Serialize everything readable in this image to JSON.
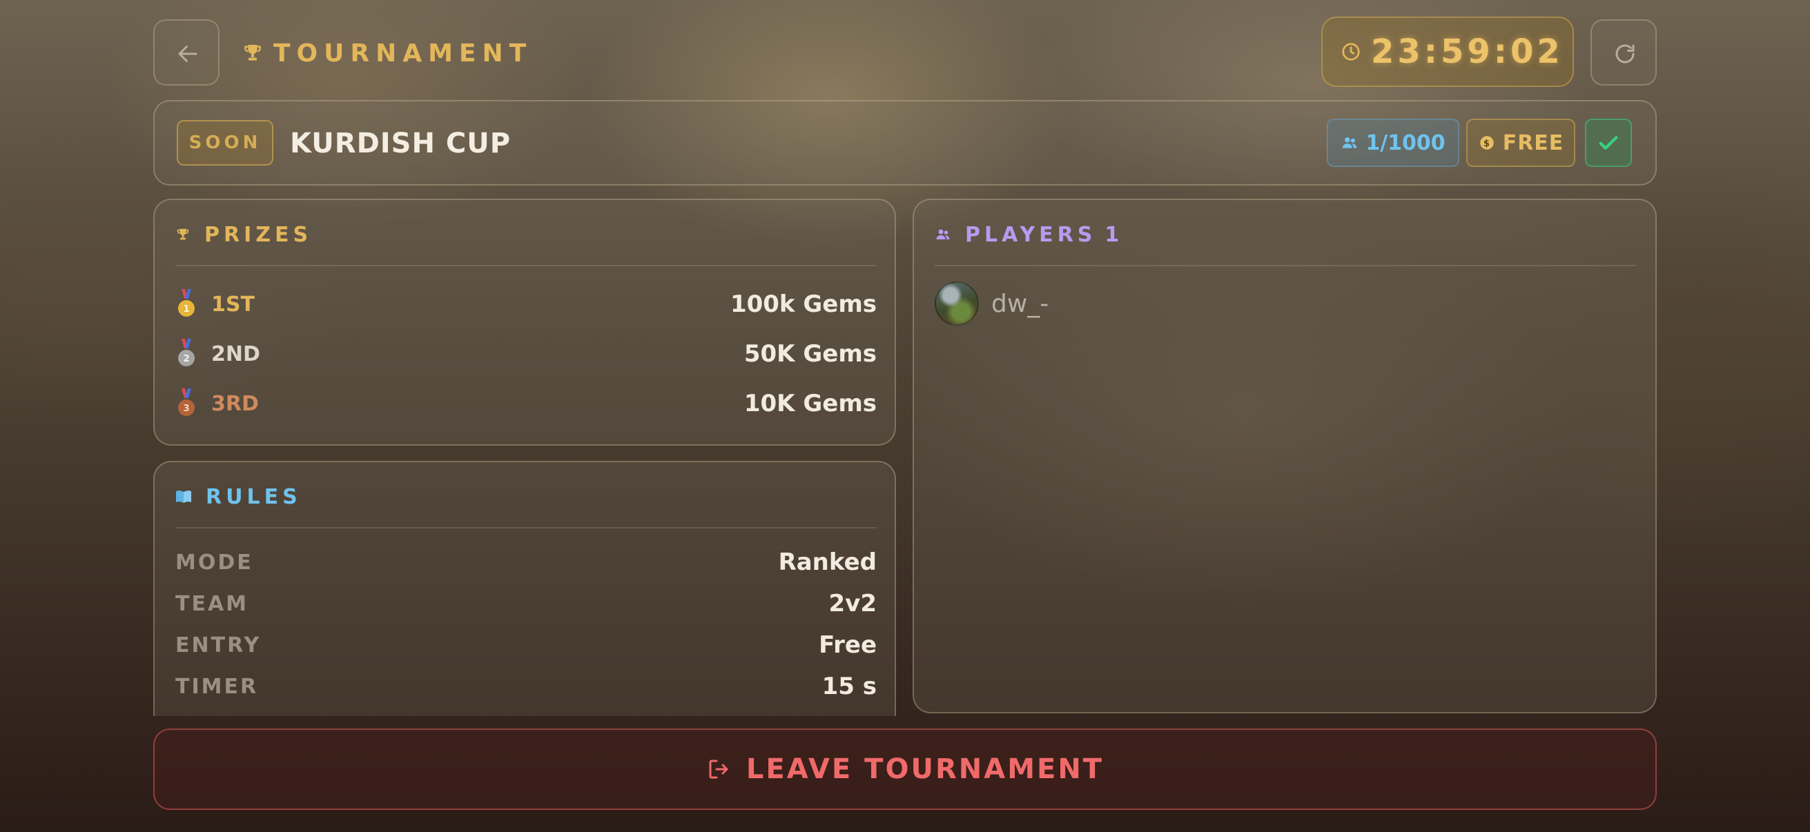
{
  "header": {
    "title": "TOURNAMENT",
    "timer": "23:59:02",
    "colors": {
      "gold": "#e3b65a"
    }
  },
  "event": {
    "status_badge": "SOON",
    "name": "KURDISH CUP",
    "capacity": "1/1000",
    "entry_fee": "FREE"
  },
  "prizes": {
    "heading": "PRIZES",
    "rows": [
      {
        "place": "1ST",
        "amount": "100k Gems",
        "medal_color": "#e7b53a",
        "medal_number": "1"
      },
      {
        "place": "2ND",
        "amount": "50K Gems",
        "medal_color": "#a6a6a6",
        "medal_number": "2"
      },
      {
        "place": "3RD",
        "amount": "10K Gems",
        "medal_color": "#b4643a",
        "medal_number": "3"
      }
    ]
  },
  "rules": {
    "heading": "RULES",
    "rows": [
      {
        "key": "MODE",
        "value": "Ranked"
      },
      {
        "key": "TEAM",
        "value": "2v2"
      },
      {
        "key": "ENTRY",
        "value": "Free"
      },
      {
        "key": "TIMER",
        "value": "15 s"
      }
    ]
  },
  "players": {
    "heading": "PLAYERS",
    "count": "1",
    "list": [
      {
        "name": "dw_-"
      }
    ]
  },
  "actions": {
    "leave_label": "LEAVE TOURNAMENT"
  },
  "icons": {
    "back": "arrow-left-icon",
    "trophy": "trophy-icon",
    "clock": "clock-icon",
    "refresh": "refresh-icon",
    "users": "users-icon",
    "coin": "coin-icon",
    "check": "check-icon",
    "book": "book-icon",
    "logout": "logout-icon"
  }
}
